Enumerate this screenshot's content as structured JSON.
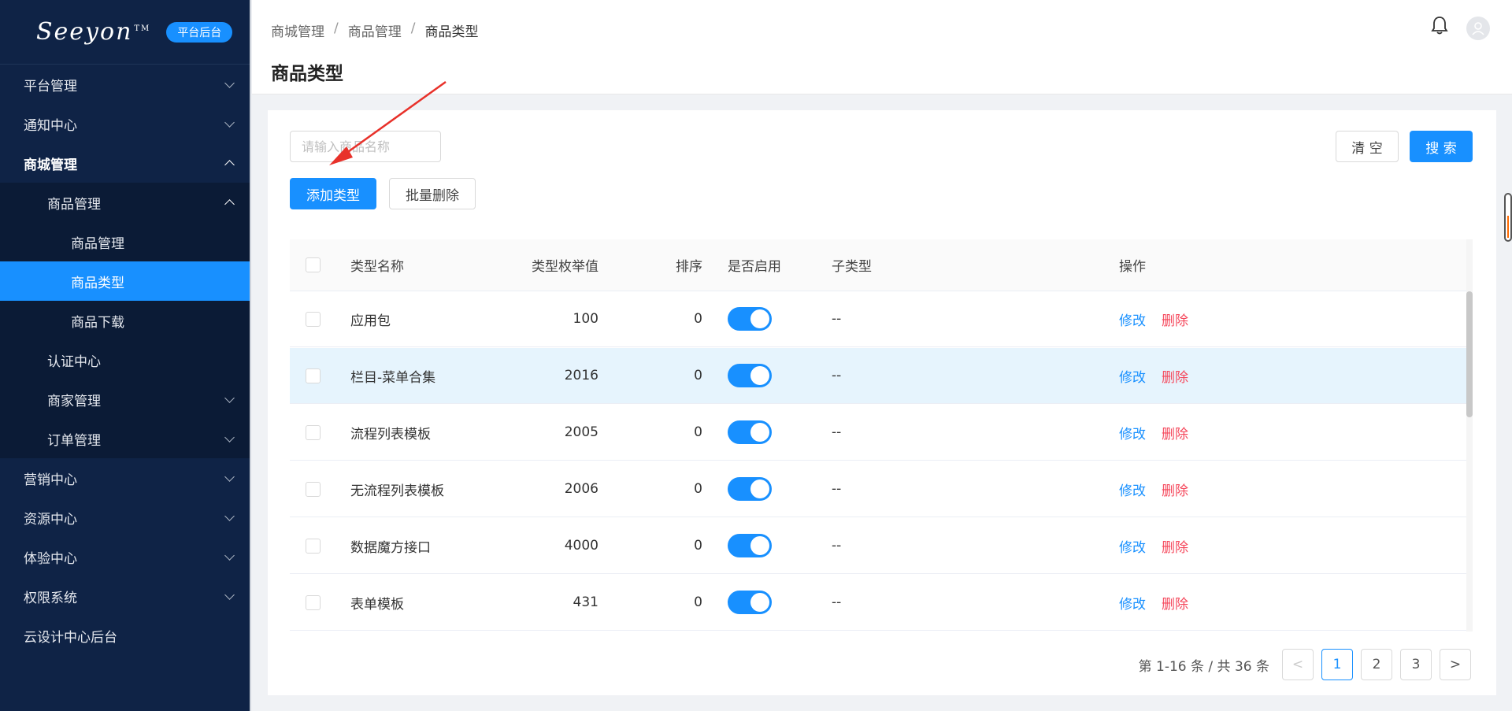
{
  "app": {
    "brand": "Seeyon",
    "brand_tm": "TM",
    "badge": "平台后台"
  },
  "sidebar": {
    "items": [
      {
        "label": "平台管理",
        "level": 1,
        "chevron": "down"
      },
      {
        "label": "通知中心",
        "level": 1,
        "chevron": "down"
      },
      {
        "label": "商城管理",
        "level": 1,
        "chevron": "up",
        "expanded": true
      },
      {
        "label": "商品管理",
        "level": 2,
        "chevron": "up",
        "expanded": true
      },
      {
        "label": "商品管理",
        "level": 3
      },
      {
        "label": "商品类型",
        "level": 3,
        "active": true
      },
      {
        "label": "商品下载",
        "level": 3
      },
      {
        "label": "认证中心",
        "level": 2
      },
      {
        "label": "商家管理",
        "level": 2,
        "chevron": "down"
      },
      {
        "label": "订单管理",
        "level": 2,
        "chevron": "down"
      },
      {
        "label": "营销中心",
        "level": 1,
        "chevron": "down"
      },
      {
        "label": "资源中心",
        "level": 1,
        "chevron": "down"
      },
      {
        "label": "体验中心",
        "level": 1,
        "chevron": "down"
      },
      {
        "label": "权限系统",
        "level": 1,
        "chevron": "down"
      },
      {
        "label": "云设计中心后台",
        "level": 1
      }
    ]
  },
  "header": {
    "breadcrumb": [
      "商城管理",
      "商品管理",
      "商品类型"
    ],
    "separator": "/",
    "title": "商品类型",
    "icons": [
      "bell-icon",
      "user-avatar-icon"
    ]
  },
  "toolbar": {
    "search_placeholder": "请输入商品名称",
    "search_value": "",
    "clear_label": "清 空",
    "search_label": "搜 索",
    "add_label": "添加类型",
    "batch_delete_label": "批量删除"
  },
  "table": {
    "columns": [
      "类型名称",
      "类型枚举值",
      "排序",
      "是否启用",
      "子类型",
      "操作"
    ],
    "rows": [
      {
        "name": "应用包",
        "enum": "100",
        "sort": "0",
        "enabled": true,
        "sub": "--"
      },
      {
        "name": "栏目-菜单合集",
        "enum": "2016",
        "sort": "0",
        "enabled": true,
        "sub": "--",
        "highlighted": true
      },
      {
        "name": "流程列表模板",
        "enum": "2005",
        "sort": "0",
        "enabled": true,
        "sub": "--"
      },
      {
        "name": "无流程列表模板",
        "enum": "2006",
        "sort": "0",
        "enabled": true,
        "sub": "--"
      },
      {
        "name": "数据魔方接口",
        "enum": "4000",
        "sort": "0",
        "enabled": true,
        "sub": "--"
      },
      {
        "name": "表单模板",
        "enum": "431",
        "sort": "0",
        "enabled": true,
        "sub": "--"
      }
    ],
    "edit_label": "修改",
    "delete_label": "删除"
  },
  "pagination": {
    "total_text": "第 1-16 条 / 共 36 条",
    "prev": "<",
    "next": ">",
    "pages": [
      "1",
      "2",
      "3"
    ],
    "current": "1"
  },
  "colors": {
    "sidebar_bg": "#0f2346",
    "primary": "#1890ff",
    "danger": "#f5475b",
    "annotation_arrow": "#e8312a"
  }
}
